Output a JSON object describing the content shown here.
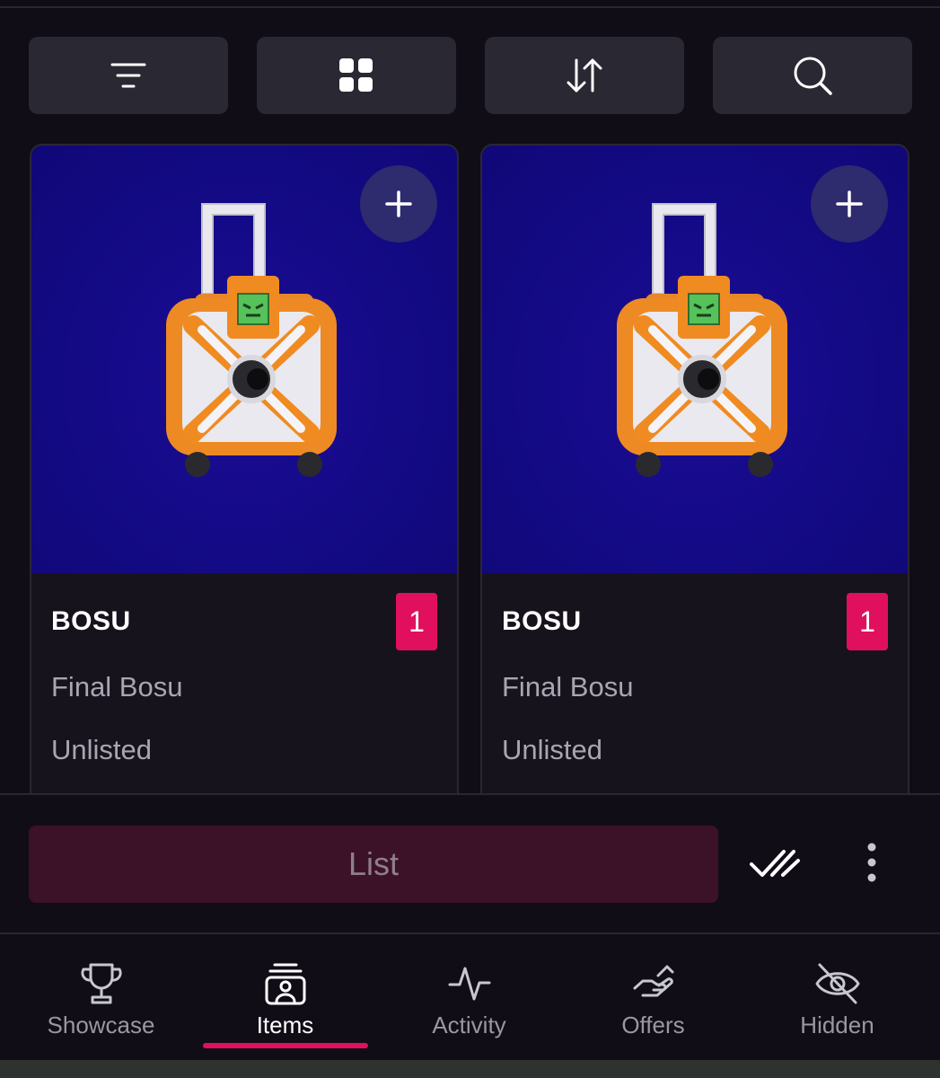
{
  "toolbar": {
    "buttons": [
      {
        "icon": "filter-icon"
      },
      {
        "icon": "grid-view-icon"
      },
      {
        "icon": "sort-icon"
      },
      {
        "icon": "search-icon"
      }
    ]
  },
  "items": [
    {
      "name": "BOSU",
      "quantity": "1",
      "collection": "Final Bosu",
      "status": "Unlisted",
      "add_icon": "plus-icon",
      "image": "orange-white-suitcase-robot"
    },
    {
      "name": "BOSU",
      "quantity": "1",
      "collection": "Final Bosu",
      "status": "Unlisted",
      "add_icon": "plus-icon",
      "image": "orange-white-suitcase-robot"
    }
  ],
  "action_bar": {
    "list_label": "List",
    "select_all_icon": "double-check-icon",
    "more_icon": "vertical-dots-icon"
  },
  "bottom_nav": {
    "active": "Items",
    "items": [
      {
        "label": "Showcase",
        "icon": "trophy-icon"
      },
      {
        "label": "Items",
        "icon": "items-stack-icon"
      },
      {
        "label": "Activity",
        "icon": "activity-pulse-icon"
      },
      {
        "label": "Offers",
        "icon": "offer-hand-icon"
      },
      {
        "label": "Hidden",
        "icon": "eye-off-icon"
      }
    ]
  },
  "colors": {
    "background": "#100d17",
    "accent": "#e0105e",
    "card_image_bg": "#130a85",
    "list_button_bg": "#3c1228"
  }
}
